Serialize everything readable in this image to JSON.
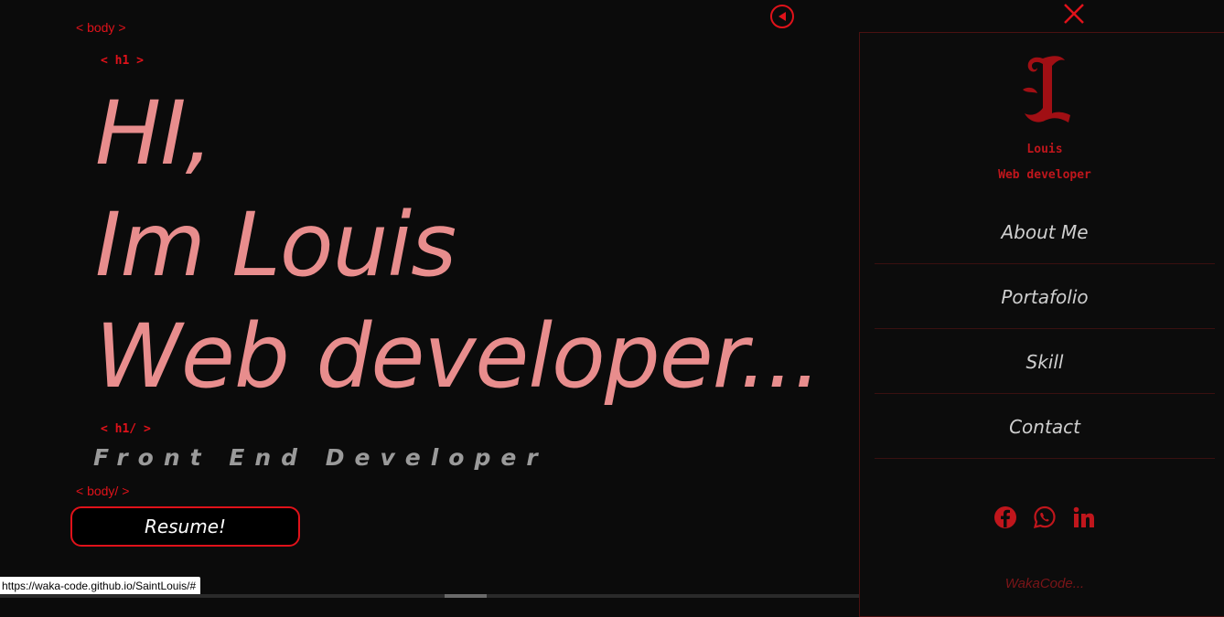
{
  "tags": {
    "body_open": "< body >",
    "h1_open": "< h1 >",
    "h1_close": "< h1/ >",
    "body_close": "< body/ >"
  },
  "hero": {
    "line1": "HI,",
    "line2": "Im Louis",
    "line3": "Web developer..."
  },
  "subtitle": "Front End Developer",
  "resume_button": "Resume!",
  "controls": {
    "collapse_icon": "triangle-left-circle-icon",
    "close_icon": "x-close-icon"
  },
  "sidebar": {
    "logo_icon": "gothic-letter-l-logo",
    "profile_name": "Louis",
    "profile_role": "Web developer",
    "nav": [
      {
        "label": "About Me"
      },
      {
        "label": "Portafolio"
      },
      {
        "label": "Skill"
      },
      {
        "label": "Contact"
      }
    ],
    "social_icons": [
      "facebook-icon",
      "whatsapp-icon",
      "linkedin-icon"
    ],
    "footer_brand": "WakaCode..."
  },
  "status_bar_url": "https://waka-code.github.io/SaintLouis/#",
  "colors": {
    "accent_red": "#e0121a",
    "hero_pink": "#e88d8d",
    "background": "#0b0b0b"
  }
}
